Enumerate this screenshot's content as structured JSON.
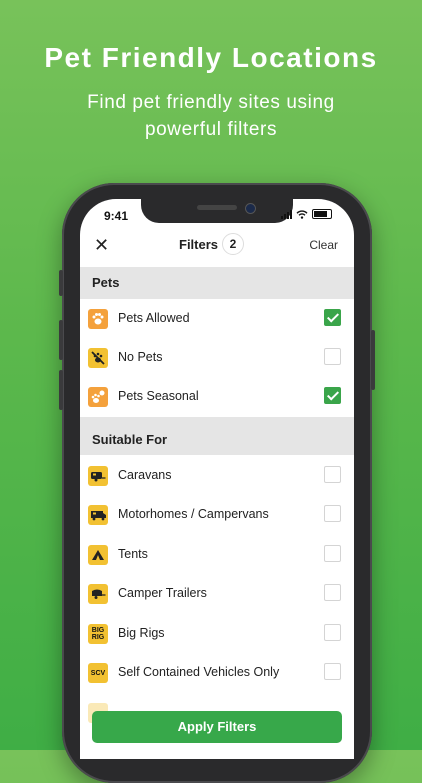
{
  "promo": {
    "title": "Pet Friendly Locations",
    "subtitle": "Find pet friendly sites using powerful filters"
  },
  "status_bar": {
    "time": "9:41"
  },
  "nav": {
    "close_icon": "close-icon",
    "title": "Filters",
    "count": "2",
    "clear_label": "Clear"
  },
  "sections": {
    "pets": {
      "title": "Pets",
      "items": [
        {
          "label": "Pets Allowed",
          "icon": "paw-icon",
          "checked": true
        },
        {
          "label": "No Pets",
          "icon": "no-pets-icon",
          "checked": false
        },
        {
          "label": "Pets Seasonal",
          "icon": "pets-seasonal-icon",
          "checked": true
        }
      ]
    },
    "suitable": {
      "title": "Suitable For",
      "items": [
        {
          "label": "Caravans",
          "icon": "caravan-icon",
          "checked": false
        },
        {
          "label": "Motorhomes / Campervans",
          "icon": "motorhome-icon",
          "checked": false
        },
        {
          "label": "Tents",
          "icon": "tent-icon",
          "checked": false
        },
        {
          "label": "Camper Trailers",
          "icon": "camper-trailer-icon",
          "checked": false
        },
        {
          "label": "Big Rigs",
          "icon": "big-rig-icon",
          "icon_text": "BIG RIG",
          "checked": false
        },
        {
          "label": "Self Contained Vehicles Only",
          "icon": "scv-icon",
          "icon_text": "SCV",
          "checked": false
        }
      ]
    }
  },
  "apply_label": "Apply Filters",
  "colors": {
    "background": "#5cb84c",
    "accent": "#37a84a",
    "icon_yellow": "#f2c132",
    "icon_orange": "#f4a13c"
  }
}
